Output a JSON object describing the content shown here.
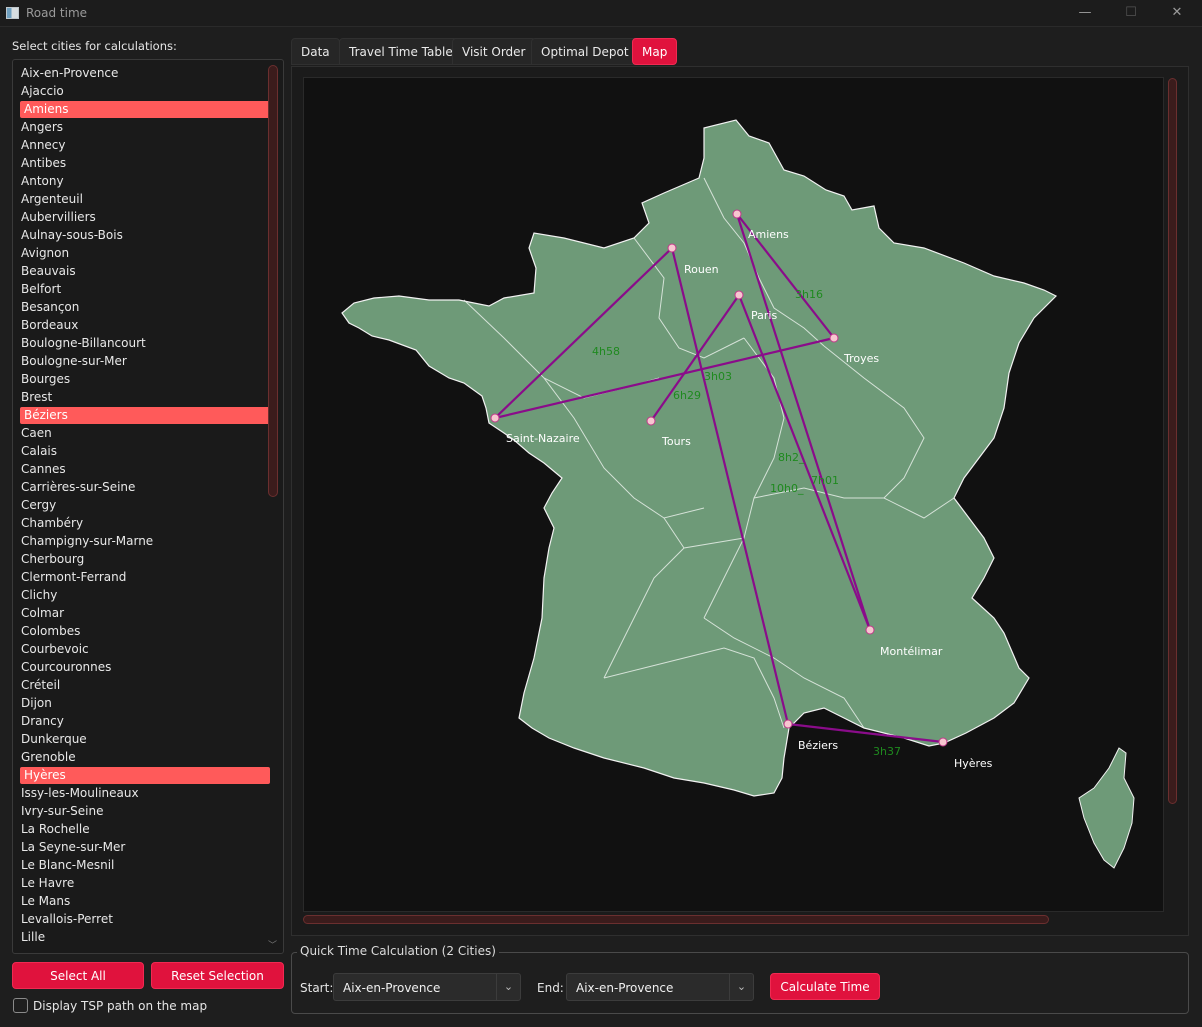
{
  "window": {
    "title": "Road time",
    "minimize": "—",
    "maximize": "☐",
    "close": "✕"
  },
  "sidebar": {
    "label": "Select cities for calculations:",
    "cities": [
      {
        "name": "Aix-en-Provence",
        "selected": false
      },
      {
        "name": "Ajaccio",
        "selected": false
      },
      {
        "name": "Amiens",
        "selected": true
      },
      {
        "name": "Angers",
        "selected": false
      },
      {
        "name": "Annecy",
        "selected": false
      },
      {
        "name": "Antibes",
        "selected": false
      },
      {
        "name": "Antony",
        "selected": false
      },
      {
        "name": "Argenteuil",
        "selected": false
      },
      {
        "name": "Aubervilliers",
        "selected": false
      },
      {
        "name": "Aulnay-sous-Bois",
        "selected": false
      },
      {
        "name": "Avignon",
        "selected": false
      },
      {
        "name": "Beauvais",
        "selected": false
      },
      {
        "name": "Belfort",
        "selected": false
      },
      {
        "name": "Besançon",
        "selected": false
      },
      {
        "name": "Bordeaux",
        "selected": false
      },
      {
        "name": "Boulogne-Billancourt",
        "selected": false
      },
      {
        "name": "Boulogne-sur-Mer",
        "selected": false
      },
      {
        "name": "Bourges",
        "selected": false
      },
      {
        "name": "Brest",
        "selected": false
      },
      {
        "name": "Béziers",
        "selected": true
      },
      {
        "name": "Caen",
        "selected": false
      },
      {
        "name": "Calais",
        "selected": false
      },
      {
        "name": "Cannes",
        "selected": false
      },
      {
        "name": "Carrières-sur-Seine",
        "selected": false
      },
      {
        "name": "Cergy",
        "selected": false
      },
      {
        "name": "Chambéry",
        "selected": false
      },
      {
        "name": "Champigny-sur-Marne",
        "selected": false
      },
      {
        "name": "Cherbourg",
        "selected": false
      },
      {
        "name": "Clermont-Ferrand",
        "selected": false
      },
      {
        "name": "Clichy",
        "selected": false
      },
      {
        "name": "Colmar",
        "selected": false
      },
      {
        "name": "Colombes",
        "selected": false
      },
      {
        "name": "Courbevoic",
        "selected": false
      },
      {
        "name": "Courcouronnes",
        "selected": false
      },
      {
        "name": "Créteil",
        "selected": false
      },
      {
        "name": "Dijon",
        "selected": false
      },
      {
        "name": "Drancy",
        "selected": false
      },
      {
        "name": "Dunkerque",
        "selected": false
      },
      {
        "name": "Grenoble",
        "selected": false
      },
      {
        "name": "Hyères",
        "selected": true
      },
      {
        "name": "Issy-les-Moulineaux",
        "selected": false
      },
      {
        "name": "Ivry-sur-Seine",
        "selected": false
      },
      {
        "name": "La Rochelle",
        "selected": false
      },
      {
        "name": "La Seyne-sur-Mer",
        "selected": false
      },
      {
        "name": "Le Blanc-Mesnil",
        "selected": false
      },
      {
        "name": "Le Havre",
        "selected": false
      },
      {
        "name": "Le Mans",
        "selected": false
      },
      {
        "name": "Levallois-Perret",
        "selected": false
      },
      {
        "name": "Lille",
        "selected": false
      }
    ],
    "select_all": "Select All",
    "reset_selection": "Reset Selection",
    "tsp_checkbox_label": "Display TSP path on the map",
    "tsp_checked": false
  },
  "tabs": [
    {
      "label": "Data",
      "active": false
    },
    {
      "label": "Travel Time Table",
      "active": false
    },
    {
      "label": "Visit Order",
      "active": false
    },
    {
      "label": "Optimal Depot",
      "active": false
    },
    {
      "label": "Map",
      "active": true
    }
  ],
  "map": {
    "land_color": "#6e9a78",
    "route_color": "#8a0c8a",
    "time_label_color": "#1f8a1f",
    "cities": [
      {
        "name": "Amiens"
      },
      {
        "name": "Rouen"
      },
      {
        "name": "Paris"
      },
      {
        "name": "Troyes"
      },
      {
        "name": "Saint-Nazaire"
      },
      {
        "name": "Tours"
      },
      {
        "name": "Montélimar"
      },
      {
        "name": "Béziers"
      },
      {
        "name": "Hyères"
      }
    ],
    "time_labels": [
      "3h16",
      "4h58",
      "3h03",
      "6h29",
      "8h2_",
      "7h01",
      "10h0_",
      "3h37"
    ]
  },
  "quick": {
    "legend": "Quick Time Calculation (2 Cities)",
    "start_label": "Start:",
    "start_value": "Aix-en-Provence",
    "end_label": "End:",
    "end_value": "Aix-en-Provence",
    "calculate_button": "Calculate Time"
  }
}
